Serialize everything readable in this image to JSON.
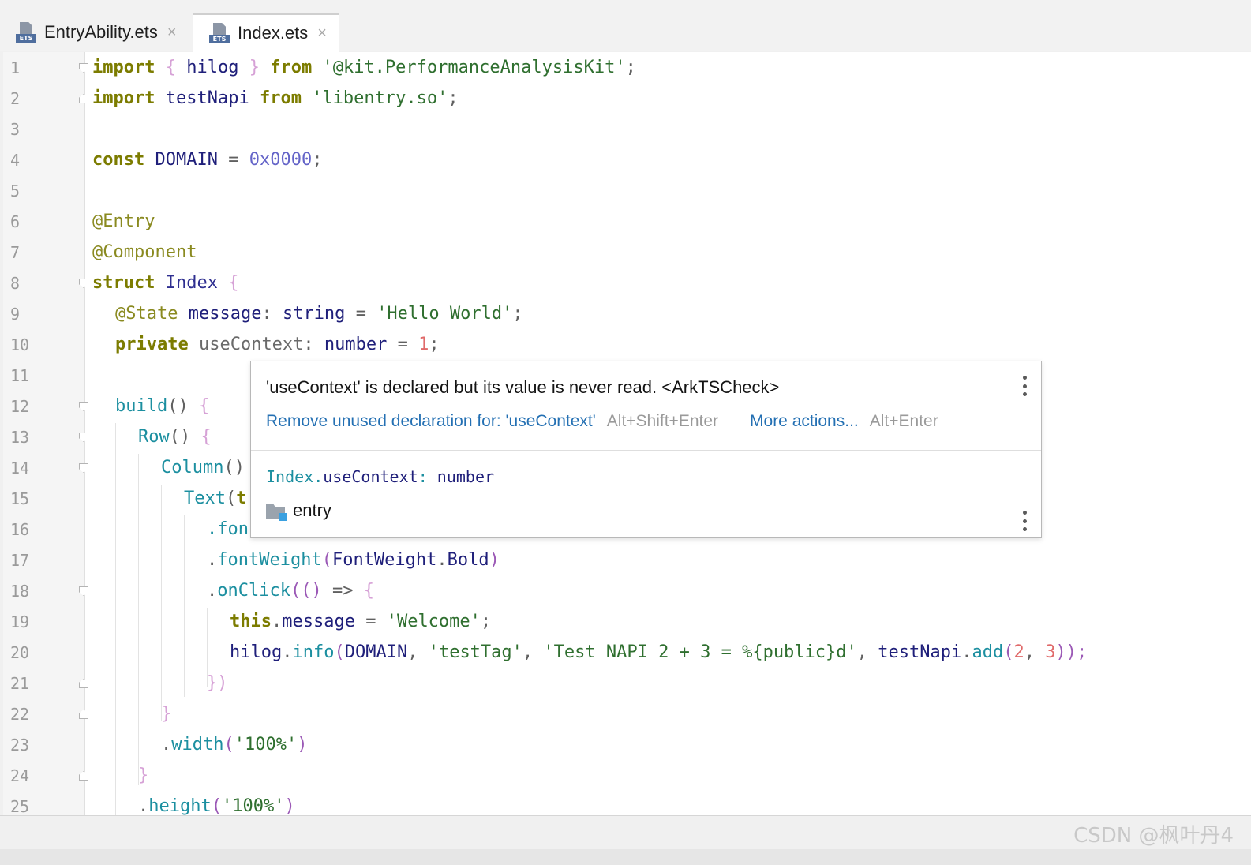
{
  "tabs": [
    {
      "label": "EntryAbility.ets",
      "icon": "ets-file-icon",
      "active": false
    },
    {
      "label": "Index.ets",
      "icon": "ets-file-icon",
      "active": true
    }
  ],
  "tab_icon_text": "ETS",
  "tab_close_glyph": "×",
  "line_numbers": [
    "1",
    "2",
    "3",
    "4",
    "5",
    "6",
    "7",
    "8",
    "9",
    "10",
    "11",
    "12",
    "13",
    "14",
    "15",
    "16",
    "17",
    "18",
    "19",
    "20",
    "21",
    "22",
    "23",
    "24",
    "25"
  ],
  "code_lines": {
    "l1": {
      "import": "import",
      "lb": "{",
      "name": "hilog",
      "rb": "}",
      "from": "from",
      "module": "'@kit.PerformanceAnalysisKit'",
      "semi": ";"
    },
    "l2": {
      "import": "import",
      "name": "testNapi",
      "from": "from",
      "module": "'libentry.so'",
      "semi": ";"
    },
    "l4": {
      "kw": "const",
      "name": "DOMAIN",
      "eq": "=",
      "value": "0x0000",
      "semi": ";"
    },
    "l6": {
      "decorator": "@Entry"
    },
    "l7": {
      "decorator": "@Component"
    },
    "l8": {
      "kw": "struct",
      "name": "Index",
      "lb": "{"
    },
    "l9": {
      "decorator": "@State",
      "name": "message",
      "colon": ":",
      "type": "string",
      "eq": "=",
      "value": "'Hello World'",
      "semi": ";"
    },
    "l10": {
      "kw": "private",
      "name": "useContext",
      "colon": ":",
      "type": "number",
      "eq": "=",
      "value": "1",
      "semi": ";"
    },
    "l12": {
      "fn": "build",
      "parens": "()",
      "lb": "{"
    },
    "l13": {
      "fn": "Row",
      "parens": "()",
      "lb": "{"
    },
    "l14": {
      "fn": "Column",
      "parens": "()"
    },
    "l15": {
      "fn": "Text",
      "paren": "(",
      "partial": "t"
    },
    "l16": {
      "partial": ".fon"
    },
    "l17": {
      "dot": ".",
      "fn": "fontWeight",
      "lp": "(",
      "arg": "FontWeight",
      "dot2": ".",
      "prop": "Bold",
      "rp": ")"
    },
    "l18": {
      "dot": ".",
      "fn": "onClick",
      "lp": "((",
      "arrow_paren": ")",
      "arrow": "=>",
      "lb": "{"
    },
    "l19": {
      "kw": "this",
      "dot": ".",
      "prop": "message",
      "eq": "=",
      "value": "'Welcome'",
      "semi": ";"
    },
    "l20": {
      "obj": "hilog",
      "dot": ".",
      "fn": "info",
      "lp": "(",
      "a1": "DOMAIN",
      "c1": ",",
      "a2": "'testTag'",
      "c2": ",",
      "a3": "'Test NAPI 2 + 3 = %{public}d'",
      "c3": ",",
      "a4": "testNapi",
      "dot2": ".",
      "fn2": "add",
      "lp2": "(",
      "n1": "2",
      "c4": ",",
      "n2": "3",
      "rp": "));"
    },
    "l21": {
      "close": "})"
    },
    "l22": {
      "close": "}"
    },
    "l23": {
      "dot": ".",
      "fn": "width",
      "lp": "(",
      "value": "'100%'",
      "rp": ")"
    },
    "l24": {
      "close": "}"
    },
    "l25": {
      "dot": ".",
      "fn": "height",
      "lp": "(",
      "value": "'100%'",
      "rp": ")"
    }
  },
  "popup": {
    "message": "'useContext' is declared but its value is never read. <ArkTSCheck>",
    "action_primary": "Remove unused declaration for: 'useContext'",
    "action_primary_shortcut": "Alt+Shift+Enter",
    "action_more": "More actions...",
    "action_more_shortcut": "Alt+Enter",
    "decl_class": "Index",
    "decl_dot": ".",
    "decl_member": "useContext",
    "decl_colon": ":",
    "decl_type": "number",
    "module": "entry"
  },
  "watermark": "CSDN @枫叶丹4"
}
